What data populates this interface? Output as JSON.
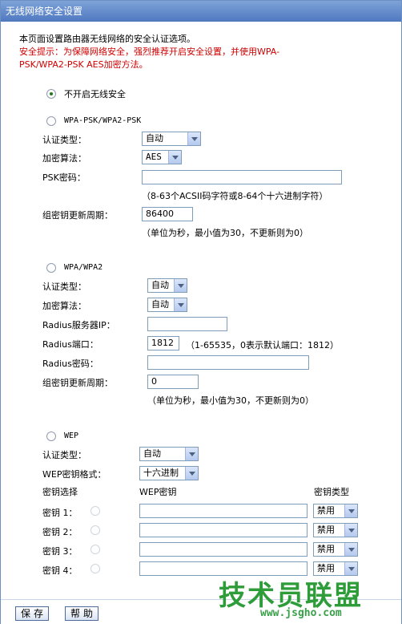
{
  "window": {
    "title": "无线网络安全设置"
  },
  "intro": {
    "line1": "本页面设置路由器无线网络的安全认证选项。",
    "warn1": "安全提示：为保障网络安全，强烈推荐开启安全设置，并使用WPA-",
    "warn2": "PSK/WPA2-PSK AES加密方法。"
  },
  "none": {
    "label": "不开启无线安全",
    "selected": true
  },
  "psk": {
    "label": "WPA-PSK/WPA2-PSK",
    "auth_label": "认证类型：",
    "auth_value": "自动",
    "enc_label": "加密算法：",
    "enc_value": "AES",
    "key_label": "PSK密码：",
    "key_value": "",
    "key_hint": "（8-63个ACSII码字符或8-64个十六进制字符）",
    "renew_label": "组密钥更新周期：",
    "renew_value": "86400",
    "renew_hint": "（单位为秒，最小值为30，不更新则为0）"
  },
  "wpa": {
    "label": "WPA/WPA2",
    "auth_label": "认证类型：",
    "auth_value": "自动",
    "enc_label": "加密算法：",
    "enc_value": "自动",
    "ip_label": "Radius服务器IP：",
    "ip_value": "",
    "port_label": "Radius端口：",
    "port_value": "1812",
    "port_hint": "（1-65535，0表示默认端口：1812）",
    "pwd_label": "Radius密码：",
    "pwd_value": "",
    "renew_label": "组密钥更新周期：",
    "renew_value": "0",
    "renew_hint": "（单位为秒，最小值为30，不更新则为0）"
  },
  "wep": {
    "label": "WEP",
    "auth_label": "认证类型：",
    "auth_value": "自动",
    "format_label": "WEP密钥格式：",
    "format_value": "十六进制",
    "col_select": "密钥选择",
    "col_key": "WEP密钥",
    "col_type": "密钥类型",
    "keys": [
      {
        "label": "密钥 1：",
        "value": "",
        "type": "禁用"
      },
      {
        "label": "密钥 2：",
        "value": "",
        "type": "禁用"
      },
      {
        "label": "密钥 3：",
        "value": "",
        "type": "禁用"
      },
      {
        "label": "密钥 4：",
        "value": "",
        "type": "禁用"
      }
    ]
  },
  "footer": {
    "save": "保存",
    "help": "帮助"
  },
  "watermark": {
    "text": "技术员联盟",
    "url": "www.jsgho.com"
  }
}
